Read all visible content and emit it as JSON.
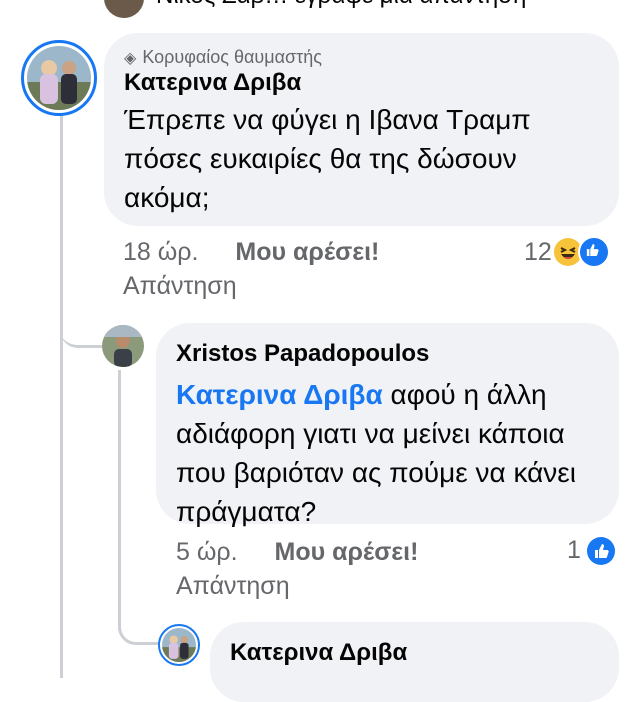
{
  "top_partial": {
    "text": "Νίκος Ζαβ… έγραψε μια απάντηση"
  },
  "comment1": {
    "badge": "Κορυφαίος θαυμαστής",
    "badge_icon": "diamond-icon",
    "author": "Κατερινα Δριβα",
    "lines": [
      "Έπρεπε να φύγει η Ιβανα Τραμπ",
      "πόσες ευκαιρίες θα της δώσουν",
      "ακόμα;"
    ],
    "time": "18 ώρ.",
    "like_label": "Μου αρέσει!",
    "reply_label": "Απάντηση",
    "reaction_count": "12",
    "reactions": [
      "haha-icon",
      "like-icon"
    ]
  },
  "reply1": {
    "author": "Xristos Papadopoulos",
    "mention": "Κατερινα Δριβα",
    "line1_rest": " αφού η άλλη",
    "lines": [
      "αδιάφορη γιατι να μείνει κάποια",
      "που βαριόταν ας πούμε να κάνει",
      "πράγματα?"
    ],
    "time": "5 ώρ.",
    "like_label": "Μου αρέσει!",
    "reply_label": "Απάντηση",
    "reaction_count": "1",
    "reactions": [
      "like-icon"
    ]
  },
  "reply2": {
    "author": "Κατερινα Δριβα"
  },
  "colors": {
    "link": "#1877f2",
    "bubble": "#f0f2f5",
    "meta": "#65676b",
    "line": "#ccd0d5"
  }
}
